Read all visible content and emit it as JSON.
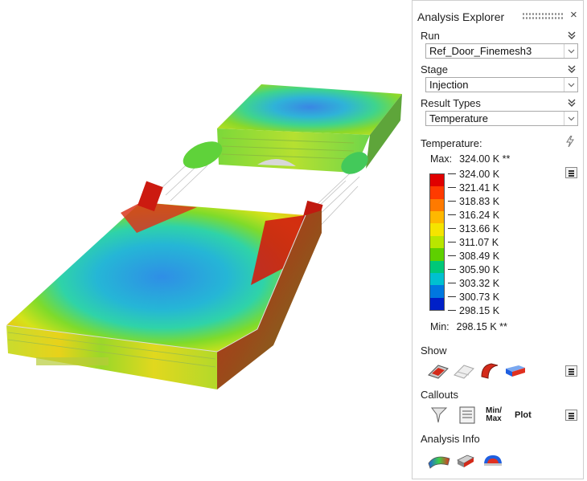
{
  "panel": {
    "title": "Analysis Explorer",
    "close_glyph": "×",
    "run": {
      "label": "Run",
      "value": "Ref_Door_Finemesh3"
    },
    "stage": {
      "label": "Stage",
      "value": "Injection"
    },
    "result_types": {
      "label": "Result Types",
      "value": "Temperature"
    },
    "legend": {
      "title": "Temperature:",
      "max_label": "Max:",
      "max_value": "324.00 K **",
      "min_label": "Min:",
      "min_value": "298.15 K **",
      "ticks": [
        "324.00 K",
        "321.41 K",
        "318.83 K",
        "316.24 K",
        "313.66 K",
        "311.07 K",
        "308.49 K",
        "305.90 K",
        "303.32 K",
        "300.73 K",
        "298.15 K"
      ],
      "colors": [
        "#e00000",
        "#ff3a00",
        "#ff7a00",
        "#ffb800",
        "#f5e400",
        "#b8e600",
        "#5ed000",
        "#00c878",
        "#00c0d0",
        "#0078e0",
        "#0020c8"
      ]
    },
    "show": {
      "label": "Show",
      "icons": [
        "shaded-part-icon",
        "transparent-part-icon",
        "section-cut-icon",
        "box-range-icon"
      ]
    },
    "callouts": {
      "label": "Callouts",
      "minmax_top": "Min/",
      "minmax_bottom": "Max",
      "plot_label": "Plot",
      "icons": [
        "probe-icon",
        "note-icon"
      ]
    },
    "analysis_info": {
      "label": "Analysis Info",
      "icons": [
        "result-surface-icon",
        "model-info-icon",
        "mesh-info-icon"
      ]
    }
  },
  "colors": {
    "accent_red": "#d10000",
    "accent_blue": "#1f5fe0",
    "panel_border": "#cfcfcf"
  }
}
